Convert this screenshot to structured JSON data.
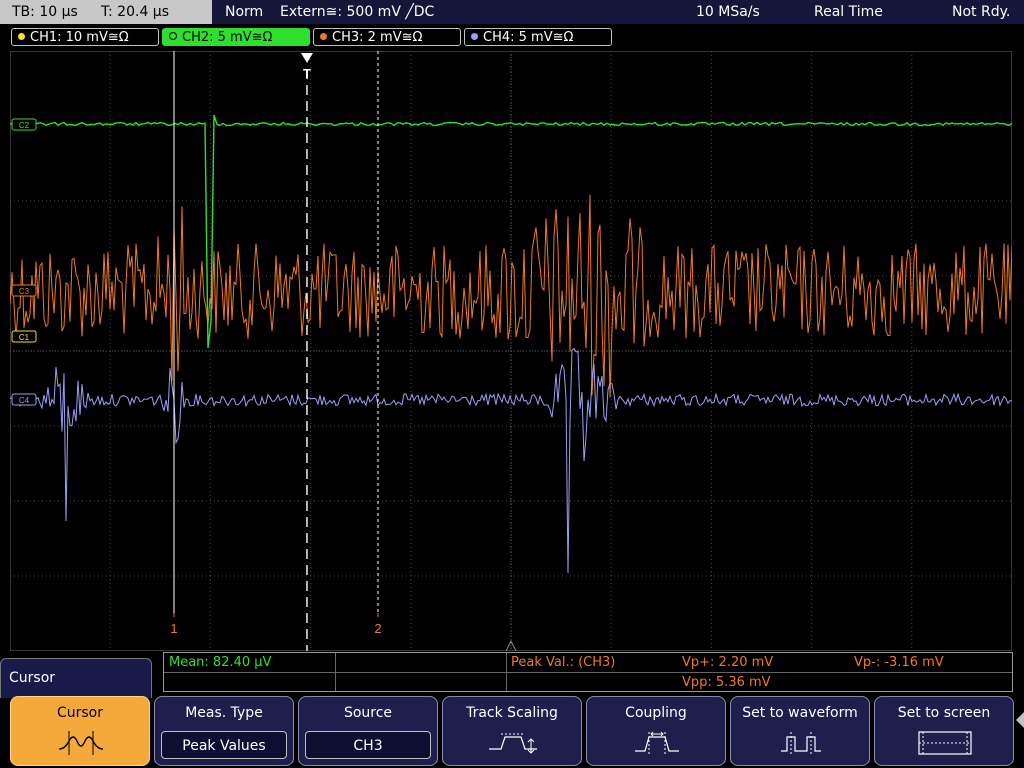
{
  "status": {
    "timebase": "TB: 10 µs",
    "trigger_time": "T: 20.4 µs",
    "mode": "Norm",
    "trigger_source": "Extern≅: 500 mV ╱DC",
    "sample_rate": "10 MSa/s",
    "acq_mode": "Real Time",
    "ready": "Not Rdy."
  },
  "channels": [
    {
      "label": "CH1: 10 mV≅Ω",
      "color": "#f5e030",
      "active": false
    },
    {
      "label": "CH2: 5 mV≅Ω",
      "color": "#2ee02e",
      "active": true
    },
    {
      "label": "CH3: 2 mV≅Ω",
      "color": "#f07a20",
      "active": false
    },
    {
      "label": "CH4: 5 mV≅Ω",
      "color": "#9d9df5",
      "active": false
    }
  ],
  "markers": {
    "ch2": "C2",
    "ch3": "C3",
    "ch1": "C1",
    "ch4": "C4",
    "cursor1": "1",
    "cursor2": "2",
    "trigger": "T"
  },
  "measurement": {
    "mean": "Mean: 82.40 µV",
    "peak_label": "Peak Val.:  (CH3)",
    "vp_plus": "Vp+: 2.20 mV",
    "vp_minus": "Vp-: -3.16 mV",
    "vpp": "Vpp: 5.36 mV"
  },
  "menu": {
    "title": "Cursor",
    "softkeys": {
      "cursor": "Cursor",
      "meas_type": "Meas. Type",
      "meas_type_value": "Peak Values",
      "source": "Source",
      "source_value": "CH3",
      "track_scaling": "Track Scaling",
      "coupling": "Coupling",
      "set_to_waveform": "Set to waveform",
      "set_to_screen": "Set to screen"
    }
  },
  "colors": {
    "ch1": "#f5e030",
    "ch2": "#2ee02e",
    "ch3": "#f07a20",
    "ch4": "#9d9df5",
    "softkey_selected": "#f5a93a",
    "status_bg": "#16163a",
    "grid": "#555555"
  },
  "icons": {
    "cursor": "cursor-waveform-icon",
    "track_scaling": "track-scaling-icon",
    "coupling": "coupling-icon",
    "set_to_waveform": "set-to-waveform-icon",
    "set_to_screen": "set-to-screen-icon"
  }
}
